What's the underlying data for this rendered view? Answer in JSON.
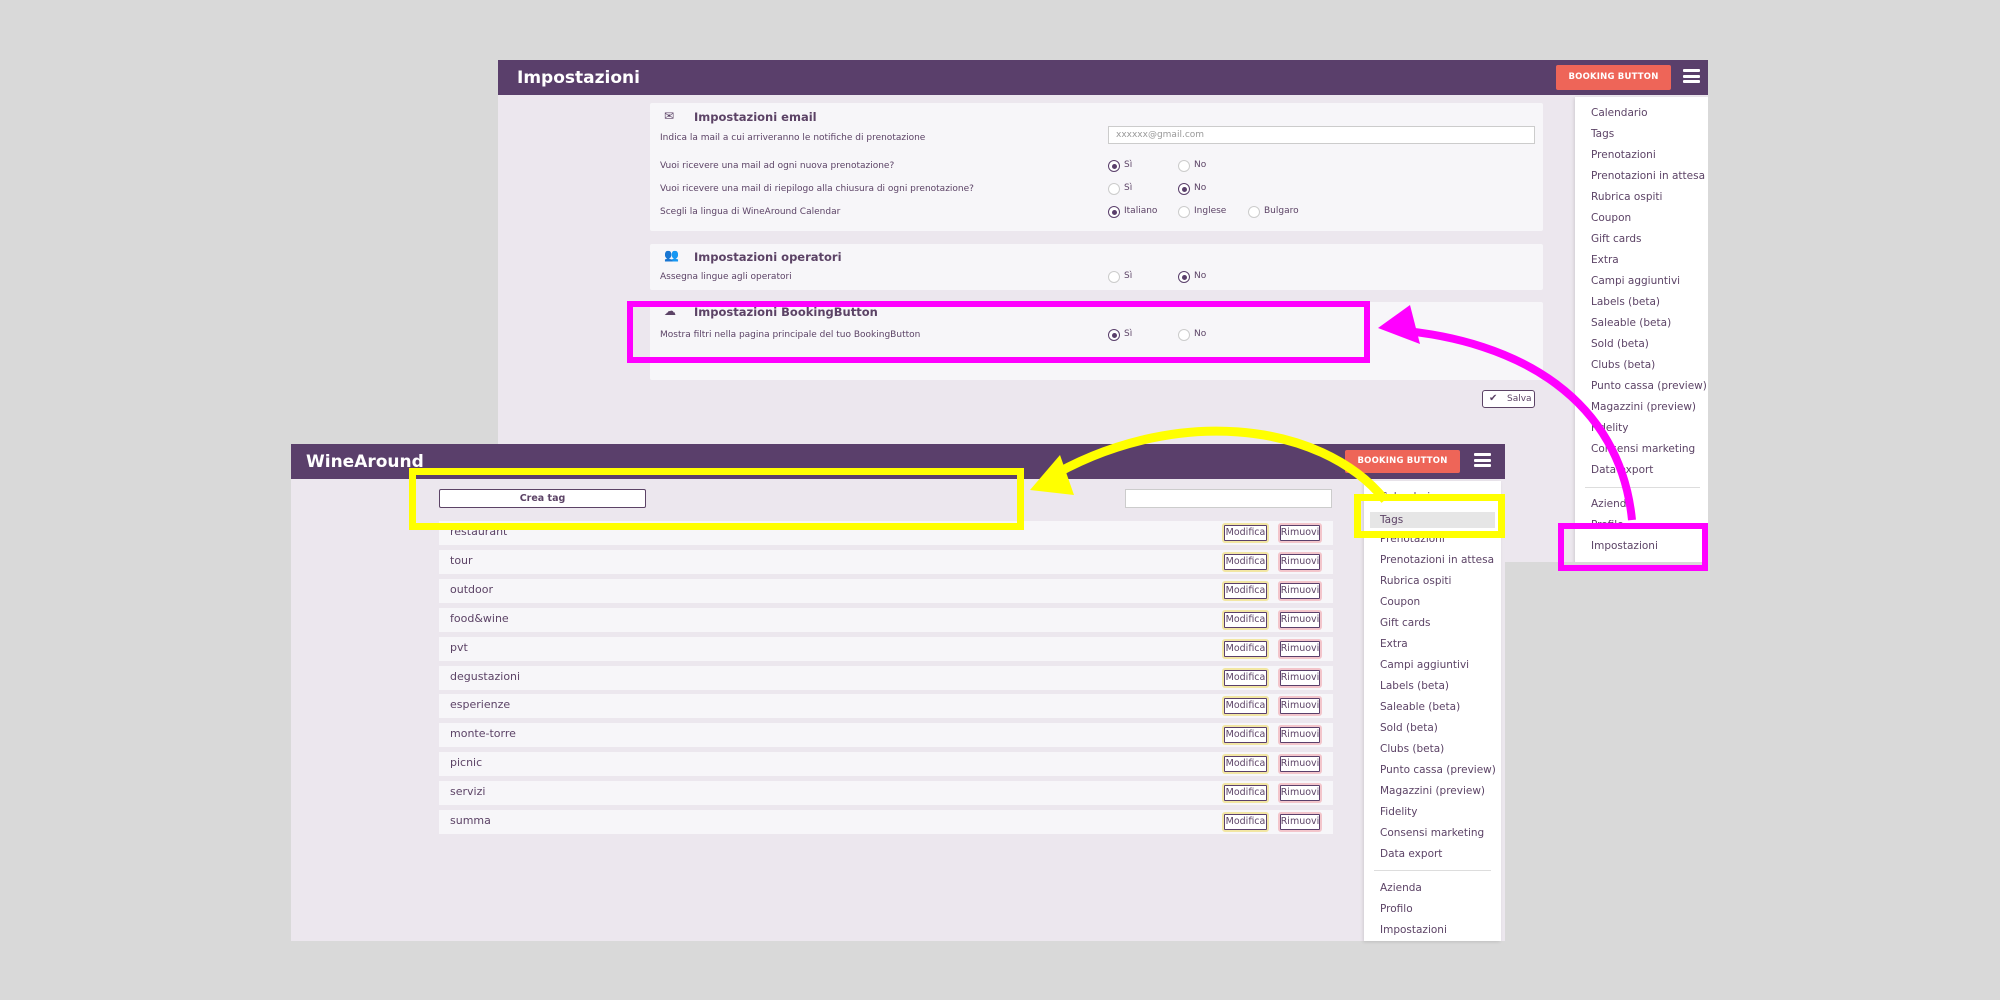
{
  "back_window": {
    "title": "Impostazioni",
    "booking_button": "BOOKING BUTTON",
    "menu_items": [
      "Calendario",
      "Tags",
      "Prenotazioni",
      "Prenotazioni in attesa",
      "Rubrica ospiti",
      "Coupon",
      "Gift cards",
      "Extra",
      "Campi aggiuntivi",
      "Labels (beta)",
      "Saleable (beta)",
      "Sold (beta)",
      "Clubs (beta)",
      "Punto cassa (preview)",
      "Magazzini (preview)",
      "Fidelity",
      "Consensi marketing",
      "Data export",
      "Azienda",
      "Profilo",
      "Impostazioni"
    ],
    "email_section": {
      "title": "Impostazioni email",
      "email_label": "Indica la mail a cui arriveranno le notifiche di prenotazione",
      "email_value": "xxxxxx@gmail.com",
      "q1": "Vuoi ricevere una mail ad ogni nuova prenotazione?",
      "q2": "Vuoi ricevere una mail di riepilogo alla chiusura di ogni prenotazione?",
      "q3": "Scegli la lingua di WineAround Calendar",
      "yes": "Sì",
      "no": "No",
      "lang_it": "Italiano",
      "lang_en": "Inglese",
      "lang_bg": "Bulgaro"
    },
    "operators_section": {
      "title": "Impostazioni operatori",
      "q1": "Assegna lingue agli operatori",
      "yes": "Sì",
      "no": "No"
    },
    "booking_section": {
      "title": "Impostazioni BookingButton",
      "q1": "Mostra filtri nella pagina principale del tuo BookingButton",
      "yes": "Sì",
      "no": "No"
    },
    "save": "Salva"
  },
  "front_window": {
    "title": "WineAround",
    "booking_button": "BOOKING BUTTON",
    "create_tag": "Crea tag",
    "search_placeholder": "",
    "edit_label": "Modifica",
    "remove_label": "Rimuovi",
    "tags": [
      "restaurant",
      "tour",
      "outdoor",
      "food&wine",
      "pvt",
      "degustazioni",
      "esperienze",
      "monte-torre",
      "picnic",
      "servizi",
      "summa"
    ],
    "menu_items": [
      "Calendario",
      "Tags",
      "Prenotazioni",
      "Prenotazioni in attesa",
      "Rubrica ospiti",
      "Coupon",
      "Gift cards",
      "Extra",
      "Campi aggiuntivi",
      "Labels (beta)",
      "Saleable (beta)",
      "Sold (beta)",
      "Clubs (beta)",
      "Punto cassa (preview)",
      "Magazzini (preview)",
      "Fidelity",
      "Consensi marketing",
      "Data export",
      "Azienda",
      "Profilo",
      "Impostazioni"
    ]
  },
  "colors": {
    "header": "#5a3f6b",
    "booking_button": "#ee6558",
    "highlight_magenta": "#ff00ff",
    "highlight_yellow": "#ffff00",
    "background": "#d9d9d9"
  }
}
